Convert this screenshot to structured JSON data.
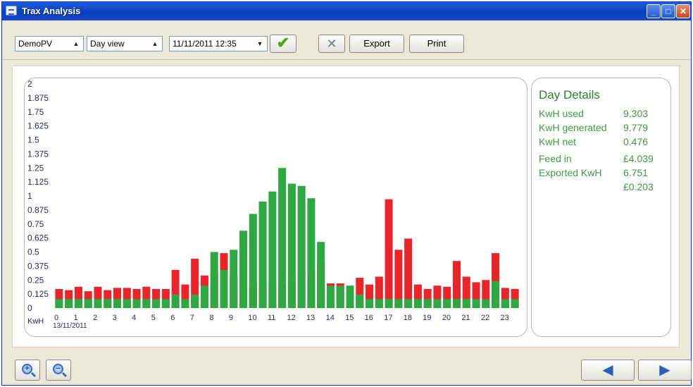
{
  "window": {
    "title": "Trax Analysis"
  },
  "toolbar": {
    "site_select": "DemoPV",
    "view_select": "Day view",
    "datetime": "11/11/2011 12:35",
    "export_label": "Export",
    "print_label": "Print"
  },
  "icons": {
    "confirm": "check-icon",
    "settings": "tools-icon",
    "zoom_in": "zoom-in-icon",
    "zoom_out": "zoom-out-icon",
    "back": "arrow-left-icon",
    "forward": "arrow-right-icon"
  },
  "colors": {
    "used": "#e8252a",
    "generated": "#2fa843",
    "detail_text": "#3f9a43"
  },
  "details": {
    "title": "Day Details",
    "rows": [
      {
        "label": "KwH used",
        "value": "9.303"
      },
      {
        "label": "KwH generated",
        "value": "9.779"
      },
      {
        "label": "KwH net",
        "value": "0.476"
      },
      {
        "label": "Feed in",
        "value": "£4.039"
      },
      {
        "label": "Exported KwH",
        "value": "6.751"
      },
      {
        "label": "",
        "value": "£0.203"
      }
    ]
  },
  "chart_data": {
    "type": "bar",
    "stacked": false,
    "ylabel": "KwH",
    "date_label": "13/11/2011",
    "ylim": [
      0,
      2
    ],
    "y_ticks": [
      "0",
      "0.125",
      "0.25",
      "0.375",
      "0.5",
      "0.625",
      "0.75",
      "0.875",
      "1",
      "1.125",
      "1.25",
      "1.375",
      "1.5",
      "1.625",
      "1.75",
      "1.875",
      "2"
    ],
    "x_ticks": [
      "0",
      "1",
      "2",
      "3",
      "4",
      "5",
      "6",
      "7",
      "8",
      "9",
      "10",
      "11",
      "12",
      "13",
      "14",
      "15",
      "16",
      "17",
      "18",
      "19",
      "20",
      "21",
      "22",
      "23"
    ],
    "series": [
      {
        "color": "#e8252a",
        "values": [
          0.17,
          0.16,
          0.19,
          0.15,
          0.19,
          0.16,
          0.18,
          0.18,
          0.17,
          0.19,
          0.17,
          0.17,
          0.34,
          0.21,
          0.44,
          0.29,
          0.31,
          0.49,
          0.28,
          0.21,
          0.22,
          0.23,
          0.19,
          0.2,
          0.27,
          0.33,
          0.31,
          0.4,
          0.22,
          0.22,
          0.13,
          0.27,
          0.21,
          0.28,
          0.97,
          0.52,
          0.62,
          0.21,
          0.17,
          0.2,
          0.19,
          0.42,
          0.28,
          0.23,
          0.25,
          0.49,
          0.18,
          0.17
        ]
      },
      {
        "color": "#2fa843",
        "values": [
          0.08,
          0.08,
          0.08,
          0.08,
          0.08,
          0.08,
          0.08,
          0.08,
          0.08,
          0.08,
          0.08,
          0.08,
          0.12,
          0.08,
          0.12,
          0.2,
          0.5,
          0.34,
          0.52,
          0.69,
          0.84,
          0.95,
          1.04,
          1.25,
          1.11,
          1.09,
          0.98,
          0.59,
          0.2,
          0.2,
          0.2,
          0.12,
          0.08,
          0.08,
          0.08,
          0.08,
          0.08,
          0.08,
          0.08,
          0.08,
          0.08,
          0.08,
          0.08,
          0.08,
          0.08,
          0.24,
          0.08,
          0.08
        ]
      }
    ]
  }
}
